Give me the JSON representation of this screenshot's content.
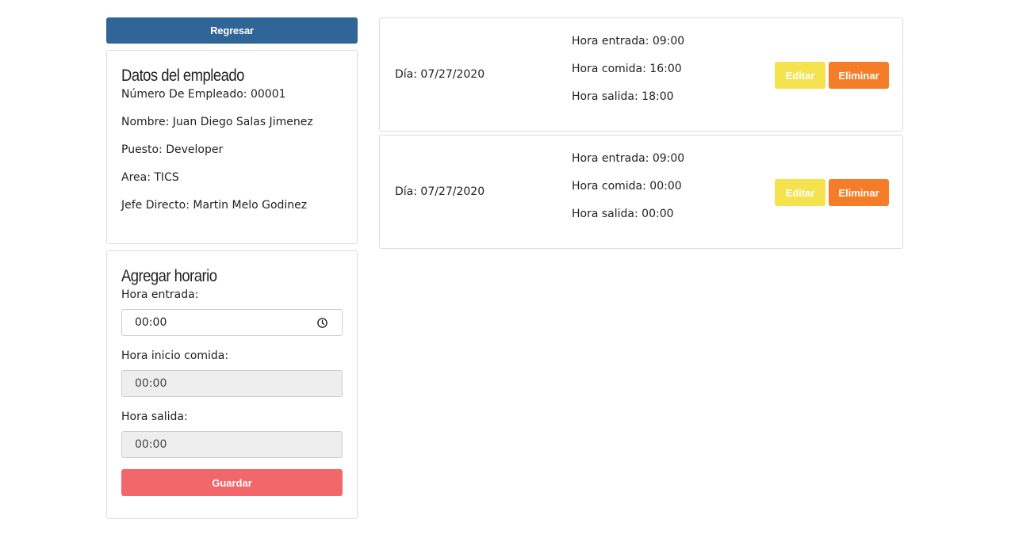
{
  "back_button": {
    "label": "Regresar"
  },
  "employee": {
    "title": "Datos del empleado",
    "lines": [
      "Número De Empleado: 00001",
      "Nombre: Juan Diego Salas Jimenez",
      "Puesto: Developer",
      "Area: TICS",
      "Jefe Directo: Martin Melo Godinez"
    ]
  },
  "schedule_form": {
    "title": "Agregar horario",
    "entry_label": "Hora entrada:",
    "entry_value": "00:00",
    "lunch_label": "Hora inicio comida:",
    "lunch_value": "00:00",
    "exit_label": "Hora salida:",
    "exit_value": "00:00",
    "save_label": "Guardar"
  },
  "records": [
    {
      "day": "Día: 07/27/2020",
      "entry": "Hora entrada: 09:00",
      "lunch": "Hora comida: 16:00",
      "exit": "Hora salida: 18:00",
      "edit_label": "Editar",
      "delete_label": "Eliminar"
    },
    {
      "day": "Día: 07/27/2020",
      "entry": "Hora entrada: 09:00",
      "lunch": "Hora comida: 00:00",
      "exit": "Hora salida: 00:00",
      "edit_label": "Editar",
      "delete_label": "Eliminar"
    }
  ],
  "colors": {
    "back_button": "#306598",
    "save_button": "#f26769",
    "edit_button": "#f4e24f",
    "delete_button": "#f57d28"
  },
  "icons": {
    "time_input": "clock-icon"
  }
}
